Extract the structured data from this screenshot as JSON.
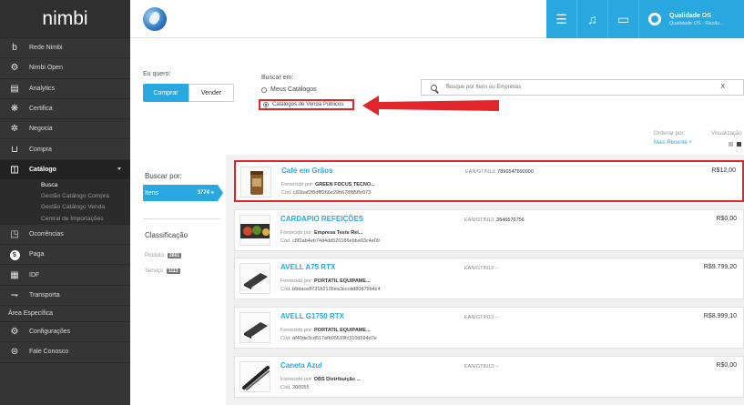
{
  "sidebar": {
    "logo": "nimbi",
    "items": [
      {
        "icon": "b-icon",
        "glyph": "b",
        "label": "Rede Nimbi"
      },
      {
        "icon": "gear-icon",
        "glyph": "⚙",
        "label": "Nimbi Open"
      },
      {
        "icon": "analytics-icon",
        "glyph": "▤",
        "label": "Analytics"
      },
      {
        "icon": "certificate-icon",
        "glyph": "❋",
        "label": "Certifica"
      },
      {
        "icon": "handshake-icon",
        "glyph": "✲",
        "label": "Negocia"
      },
      {
        "icon": "cart-icon",
        "glyph": "⊔",
        "label": "Compra"
      },
      {
        "icon": "book-icon",
        "glyph": "◫",
        "label": "Catálogo"
      }
    ],
    "catalog_sub": [
      "Busca",
      "Gestão Catálogo Compra",
      "Gestão Catálogo Venda",
      "Central de Importações"
    ],
    "items2": [
      {
        "icon": "document-icon",
        "glyph": "◳",
        "label": "Ocorrências"
      },
      {
        "icon": "dollar-icon",
        "glyph": "$",
        "label": "Paga"
      },
      {
        "icon": "idf-icon",
        "glyph": "▦",
        "label": "IDF"
      },
      {
        "icon": "truck-icon",
        "glyph": "⇁",
        "label": "Transporta"
      }
    ],
    "area_especifica": "Área Específica",
    "items3": [
      {
        "icon": "settings-icon",
        "glyph": "⚙",
        "label": "Configurações"
      },
      {
        "icon": "chat-icon",
        "glyph": "⊜",
        "label": "Fale Conosco"
      }
    ]
  },
  "topbar": {
    "user_name": "Qualidade OS",
    "user_sub": "Qualidade OS - Razão..."
  },
  "filters": {
    "eu_quero": "Eu quero:",
    "comprar": "Comprar",
    "vender": "Vender",
    "buscar_em": "Buscar em:",
    "meus_catalogos": "Meus Catálogos",
    "catalogos_publicos": "Catálogos de Venda Públicos",
    "search_placeholder": "Busque por Itens ou Empresas",
    "clear": "X",
    "ordenar_por": "Ordenar por:",
    "mais_recente": "Mais Recente ˅",
    "visualizacao": "Visualização",
    "buscar_por": "Buscar por:",
    "itens": "Itens",
    "itens_count": "3774 »",
    "classificacao": "Classificação",
    "produto": "Produto",
    "produto_count": "2661",
    "servico": "Serviço",
    "servico_count": "1113"
  },
  "results": [
    {
      "title": "Café em Grãos",
      "supplier_prefix": "Fornecido por:",
      "supplier": "GREEN FOCUS TECNO...",
      "code_prefix": "Cód.",
      "code": "c81baf2f8dfff266e29b678f85ffe073",
      "ean_prefix": "EAN/GTIN13:",
      "ean": "7896547890000",
      "price": "R$12,00",
      "thumb": "coffee-bag"
    },
    {
      "title": "CARDAPIO REFEIÇÕES",
      "supplier_prefix": "Fornecido por:",
      "supplier": "Empresa Teste Rel...",
      "code_prefix": "Cód.",
      "code": "c8f2ab4eb74d4dd520186ebba93c4e09",
      "ean_prefix": "EAN/GTIN13:",
      "ean": "3546576756",
      "price": "R$0,00",
      "thumb": "food"
    },
    {
      "title": "AVELL A75 RTX",
      "supplier_prefix": "Fornecido por:",
      "supplier": "PORTATIL EQUIPAME...",
      "code_prefix": "Cód.",
      "code": "bbdace8731b2126ea3cccdd80d79b4c4",
      "ean_prefix": "EAN/GTIN13:",
      "ean": "-",
      "price": "R$9.799,20",
      "thumb": "laptop"
    },
    {
      "title": "AVELL G1750 RTX",
      "supplier_prefix": "Fornecido por:",
      "supplier": "PORTATIL EQUIPAME...",
      "code_prefix": "Cód.",
      "code": "af40de3cd517afb05519fc310d594d7e",
      "ean_prefix": "EAN/GTIN13:",
      "ean": "-",
      "price": "R$8.999,10",
      "thumb": "laptop"
    },
    {
      "title": "Caneta Azul",
      "supplier_prefix": "Fornecido por:",
      "supplier": "DBS Distribuição ...",
      "code_prefix": "Cód.",
      "code": "200055",
      "ean_prefix": "EAN/GTIN13:",
      "ean": "-",
      "price": "R$0,00",
      "thumb": "pen"
    }
  ],
  "colors": {
    "accent": "#29a8e0",
    "highlight": "#e0252b",
    "sidebar": "#353535"
  }
}
